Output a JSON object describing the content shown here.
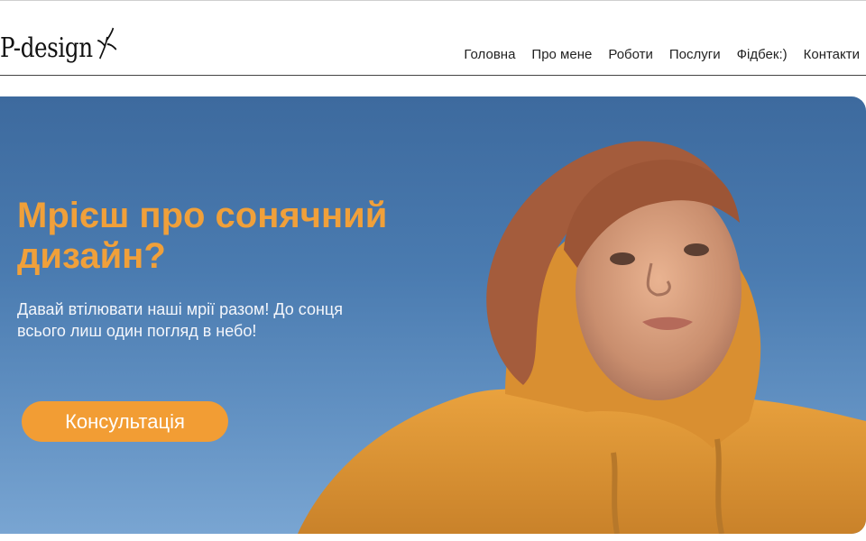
{
  "header": {
    "logo_text": "P-design"
  },
  "nav": {
    "items": [
      "Головна",
      "Про мене",
      "Роботи",
      "Послуги",
      "Фідбек:)",
      "Контакти"
    ]
  },
  "hero": {
    "headline": "Мрієш про сонячний дизайн?",
    "subtext": "Давай втілювати наші мрії разом! До сонця всього лиш один погляд в небо!",
    "cta_label": "Консультація"
  },
  "colors": {
    "accent": "#f29d34",
    "headline": "#f0a03a",
    "sky": "#4a7bb0",
    "hoodie": "#e39a36"
  }
}
